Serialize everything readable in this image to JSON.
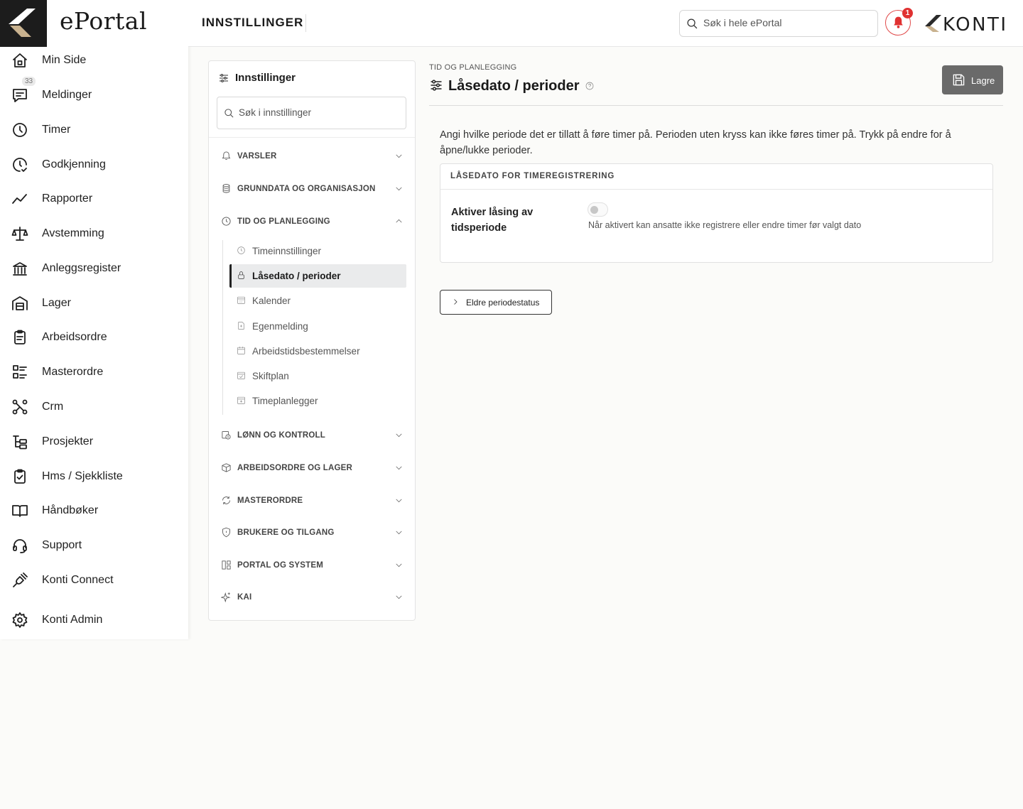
{
  "app": {
    "name": "ePortal",
    "brand": "KONTI",
    "accent_color": "#e03131",
    "primary_dark": "#1c1c1c"
  },
  "topbar": {
    "title": "INNSTILLINGER",
    "search_placeholder": "Søk i hele ePortal",
    "notification_count": "1"
  },
  "sidebar": {
    "items": [
      {
        "label": "Min Side",
        "icon": "home-icon"
      },
      {
        "label": "Meldinger",
        "icon": "message-icon",
        "badge": "33"
      },
      {
        "label": "Timer",
        "icon": "clock-icon"
      },
      {
        "label": "Godkjenning",
        "icon": "clock-check-icon"
      },
      {
        "label": "Rapporter",
        "icon": "trend-icon"
      },
      {
        "label": "Avstemming",
        "icon": "scale-icon"
      },
      {
        "label": "Anleggsregister",
        "icon": "bank-icon"
      },
      {
        "label": "Lager",
        "icon": "warehouse-icon"
      },
      {
        "label": "Arbeidsordre",
        "icon": "clipboard-icon"
      },
      {
        "label": "Masterordre",
        "icon": "list-icon"
      },
      {
        "label": "Crm",
        "icon": "network-icon"
      },
      {
        "label": "Prosjekter",
        "icon": "tree-icon"
      },
      {
        "label": "Hms / Sjekkliste",
        "icon": "clipboard-check-icon"
      },
      {
        "label": "Håndbøker",
        "icon": "book-icon"
      },
      {
        "label": "Support",
        "icon": "headset-icon"
      },
      {
        "label": "Konti Connect",
        "icon": "plug-icon"
      },
      {
        "label": "Konti Admin",
        "icon": "gear-icon"
      }
    ]
  },
  "settings": {
    "header": "Innstillinger",
    "search_placeholder": "Søk i innstillinger",
    "sections": [
      {
        "label": "VARSLER",
        "icon": "bell-icon",
        "expanded": false
      },
      {
        "label": "GRUNNDATA OG ORGANISASJON",
        "icon": "database-icon",
        "expanded": false
      },
      {
        "label": "TID OG PLANLEGGING",
        "icon": "clock-icon",
        "expanded": true
      },
      {
        "label": "LØNN OG KONTROLL",
        "icon": "payroll-icon",
        "expanded": false
      },
      {
        "label": "ARBEIDSORDRE OG LAGER",
        "icon": "box-icon",
        "expanded": false
      },
      {
        "label": "MASTERORDRE",
        "icon": "refresh-icon",
        "expanded": false
      },
      {
        "label": "BRUKERE OG TILGANG",
        "icon": "shield-icon",
        "expanded": false
      },
      {
        "label": "PORTAL OG SYSTEM",
        "icon": "layout-icon",
        "expanded": false
      },
      {
        "label": "KAI",
        "icon": "sparkle-icon",
        "expanded": false
      }
    ],
    "subitems": [
      {
        "label": "Timeinnstillinger",
        "icon": "clock-icon"
      },
      {
        "label": "Låsedato / perioder",
        "icon": "lock-icon",
        "active": true
      },
      {
        "label": "Kalender",
        "icon": "calendar-grid-icon"
      },
      {
        "label": "Egenmelding",
        "icon": "document-plus-icon"
      },
      {
        "label": "Arbeidstidsbestemmelser",
        "icon": "calendar-icon"
      },
      {
        "label": "Skiftplan",
        "icon": "calendar-check-icon"
      },
      {
        "label": "Timeplanlegger",
        "icon": "calendar-plus-icon"
      }
    ]
  },
  "content": {
    "breadcrumb": "TID OG PLANLEGGING",
    "title": "Låsedato / perioder",
    "save_label": "Lagre",
    "description": "Angi hvilke periode det er tillatt å føre timer på. Perioden uten kryss kan ikke føres timer på. Trykk på endre for å åpne/lukke perioder.",
    "card": {
      "header": "LÅSEDATO FOR TIMEREGISTRERING",
      "field_label": "Aktiver låsing av tidsperiode",
      "toggle_on": false,
      "field_help": "Når aktivert kan ansatte ikke registrere eller endre timer før valgt dato"
    },
    "older_button_label": "Eldre periodestatus"
  }
}
